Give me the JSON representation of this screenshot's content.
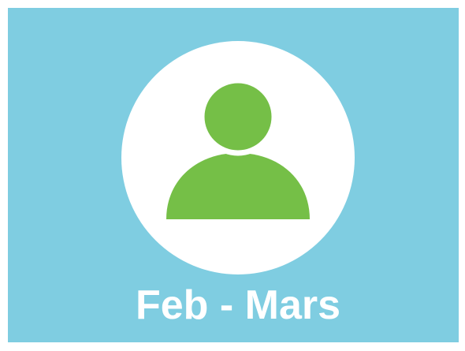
{
  "tile": {
    "label": "Feb - Mars",
    "icon": "user-icon"
  },
  "colors": {
    "background": "#7fcde1",
    "circle": "#ffffff",
    "icon": "#75bf47",
    "label": "#ffffff"
  }
}
